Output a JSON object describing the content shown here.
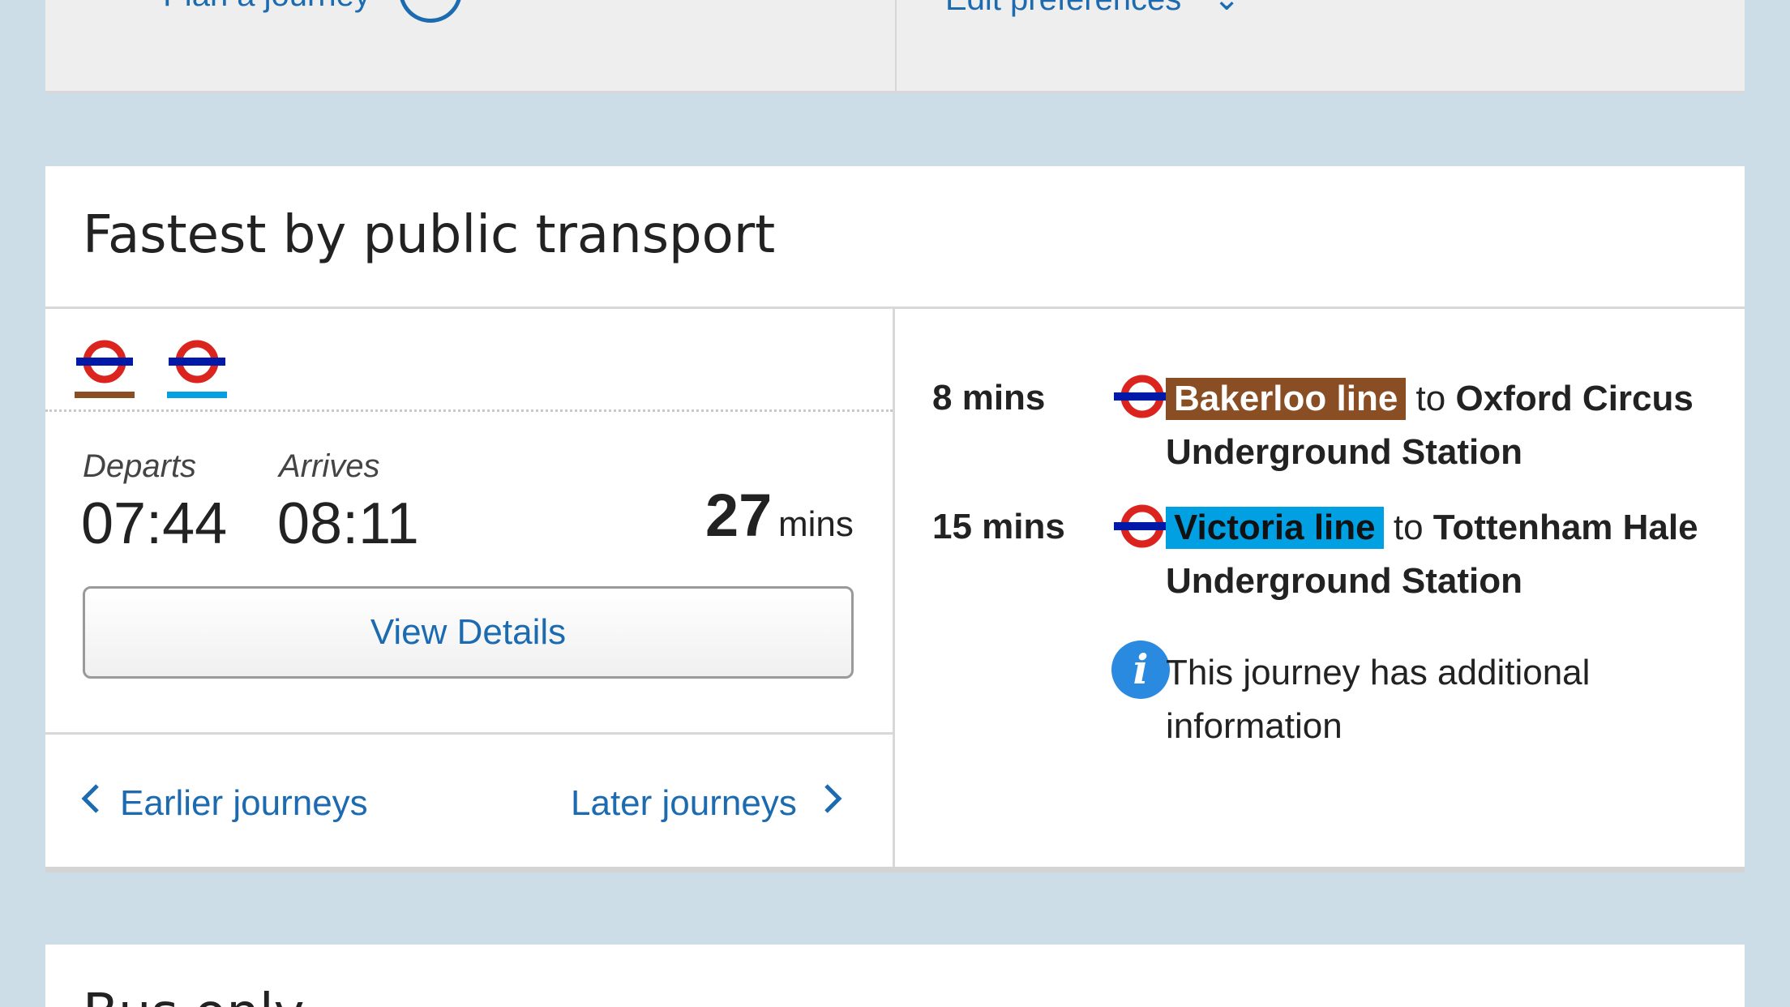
{
  "top_card": {
    "left_text": "Plan a journey",
    "right_text": "Edit preferences"
  },
  "results": {
    "title": "Fastest by public transport",
    "departs_label": "Departs",
    "departs_time": "07:44",
    "arrives_label": "Arrives",
    "arrives_time": "08:11",
    "duration_value": "27",
    "duration_unit": "mins",
    "view_details_label": "View Details",
    "earlier_label": "Earlier journeys",
    "later_label": "Later journeys",
    "mode_icons": [
      {
        "icon": "underground-roundel-icon",
        "line_color": "#894e24"
      },
      {
        "icon": "underground-roundel-icon",
        "line_color": "#00a0e2"
      }
    ],
    "legs": [
      {
        "duration": "8 mins",
        "line": "Bakerloo line",
        "line_color": "#894e24",
        "connector": "to",
        "destination": "Oxford Circus Underground Station"
      },
      {
        "duration": "15 mins",
        "line": "Victoria line",
        "line_color": "#00a0e2",
        "connector": "to",
        "destination": "Tottenham Hale Underground Station"
      }
    ],
    "info_text": "This journey has additional information"
  },
  "bottom_card": {
    "title": "Bus only"
  },
  "colors": {
    "page_background": "#cddde7",
    "link_blue": "#1c6bb0",
    "roundel_red": "#dc241f",
    "roundel_blue": "#0019a8"
  }
}
